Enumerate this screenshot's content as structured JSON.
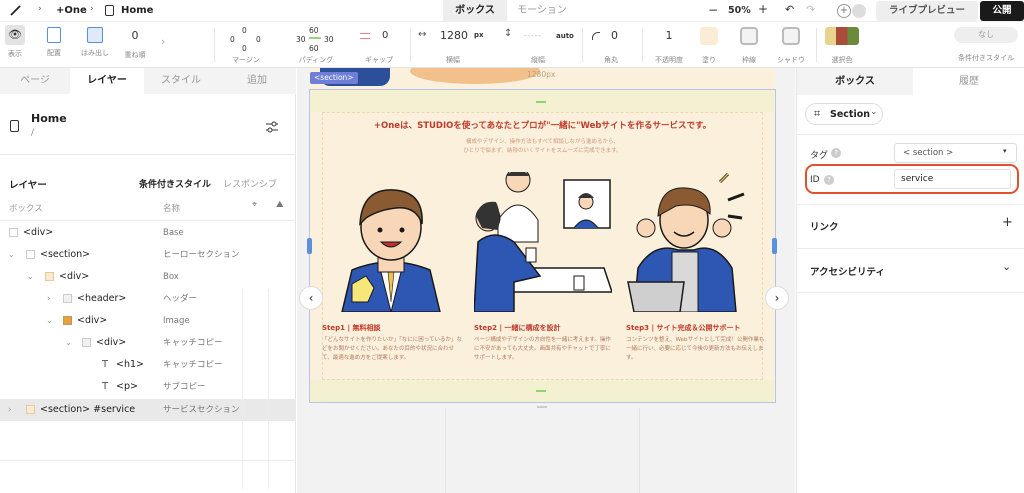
{
  "topbar": {
    "project_name": "+One",
    "page_name": "Home",
    "tab_box": "ボックス",
    "tab_motion": "モーション",
    "zoom": "50%",
    "live_preview": "ライブプレビュー",
    "publish": "公開"
  },
  "toolbar": {
    "display_label": "表示",
    "place_label": "配置",
    "overflow_label": "はみ出し",
    "zindex_value": "0",
    "zindex_label": "重ね順",
    "margin_top": "0",
    "margin_left": "0",
    "margin_right": "0",
    "margin_bottom": "0",
    "margin_label": "マージン",
    "padding_top": "60",
    "padding_left": "30",
    "padding_right": "30",
    "padding_bottom": "60",
    "padding_label": "パディング",
    "gap_value": "0",
    "gap_label": "ギャップ",
    "width_value": "1280",
    "width_unit": "px",
    "width_label": "横幅",
    "height_value": "-----",
    "height_unit": "auto",
    "height_label": "縦幅",
    "radius_value": "0",
    "radius_label": "角丸",
    "opacity_value": "1",
    "opacity_label": "不透明度",
    "fill_label": "塗り",
    "border_label": "枠線",
    "shadow_label": "シャドウ",
    "selection_label": "選択色",
    "cond_value": "なし",
    "cond_label": "条件付きスタイル"
  },
  "left": {
    "tabs": [
      "ページ",
      "レイヤー",
      "スタイル",
      "追加"
    ],
    "page_title": "Home",
    "page_path": "/",
    "layer_heading": "レイヤー",
    "cond_style": "条件付きスタイル",
    "responsive": "レスポンシブ",
    "col_box": "ボックス",
    "col_name": "名称",
    "rows": [
      {
        "tag": "<div>",
        "name": "Base"
      },
      {
        "tag": "<section>",
        "name": "ヒーローセクション"
      },
      {
        "tag": "<div>",
        "name": "Box"
      },
      {
        "tag": "<header>",
        "name": "ヘッダー"
      },
      {
        "tag": "<div>",
        "name": "Image"
      },
      {
        "tag": "<div>",
        "name": "キャッチコピー"
      },
      {
        "tag": "<h1>",
        "name": "キャッチコピー"
      },
      {
        "tag": "<p>",
        "name": "サブコピー"
      },
      {
        "tag": "<section> #service",
        "name": "サービスセクション"
      }
    ]
  },
  "canvas": {
    "section_badge": "<section>",
    "width_label": "1280px",
    "headline": "+Oneは、STUDIOを使ってあなたとプロが\"一緒に\"Webサイトを作るサービスです。",
    "sub1": "構成やデザイン、操作方法もすべて相談しながら進めるから、",
    "sub2": "ひとりで悩まず、納得のいくサイトをスムーズに完成できます。",
    "steps": [
      {
        "title": "Step1 | 無料相談",
        "desc": "「どんなサイトを作りたいか」「なにに困っているか」などをお聞かせください。あなたの目的や状況に合わせて、最適な進め方をご提案します。"
      },
      {
        "title": "Step2 | 一緒に構成を設計",
        "desc": "ページ構成やデザインの方向性を一緒に考えます。操作に不安があっても大丈夫。画面共有やチャットで丁寧にサポートします。"
      },
      {
        "title": "Step3 | サイト完成＆公開サポート",
        "desc": "コンテンツを整え、Webサイトとして完成！公開作業も一緒に行い、必要に応じて今後の更新方法もお伝えします。"
      }
    ]
  },
  "right": {
    "tab_box": "ボックス",
    "tab_history": "履歴",
    "element_type": "Section",
    "tag_label": "タグ",
    "tag_value": "< section >",
    "id_label": "ID",
    "id_value": "service",
    "link_label": "リンク",
    "a11y_label": "アクセシビリティ"
  },
  "colors": {
    "accent": "#1a1a1a",
    "highlight_ring": "#e0522f",
    "canvas_bg": "#fbf0dc",
    "headline": "#c0392b",
    "section_badge": "#6f7fd8"
  }
}
